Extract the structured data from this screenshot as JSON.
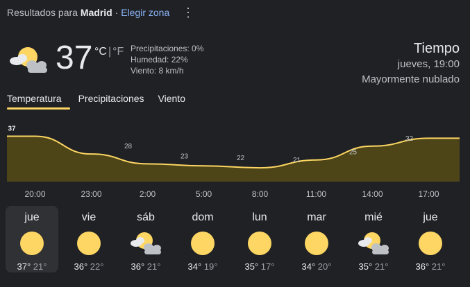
{
  "header": {
    "prefix": "Resultados para",
    "city": "Madrid",
    "separator": "·",
    "change_zone": "Elegir zona",
    "menu_icon": "more-vert-icon"
  },
  "current": {
    "icon": "partly-cloudy-icon",
    "temperature": "37",
    "unit_c": "°C",
    "unit_sep": "|",
    "unit_f": "°F",
    "precipitation": "Precipitaciones: 0%",
    "humidity": "Humedad: 22%",
    "wind": "Viento: 8 km/h"
  },
  "summary": {
    "title": "Tiempo",
    "datetime": "jueves, 19:00",
    "condition": "Mayormente nublado"
  },
  "tabs": [
    {
      "label": "Temperatura",
      "active": true
    },
    {
      "label": "Precipitaciones",
      "active": false
    },
    {
      "label": "Viento",
      "active": false
    }
  ],
  "colors": {
    "accent": "#fdd663",
    "area_fill": "#4d4518",
    "background": "#202124",
    "card": "#303134"
  },
  "chart_data": {
    "type": "area",
    "x": [
      "19:00",
      "20:00",
      "23:00",
      "2:00",
      "5:00",
      "8:00",
      "11:00",
      "14:00",
      "17:00"
    ],
    "values": [
      37,
      37,
      28,
      23,
      22,
      21,
      25,
      32,
      36
    ],
    "labels": [
      "37",
      "",
      "28",
      "23",
      "22",
      "21",
      "25",
      "32",
      "36"
    ],
    "x_tick_labels": [
      "20:00",
      "23:00",
      "2:00",
      "5:00",
      "8:00",
      "11:00",
      "14:00",
      "17:00"
    ]
  },
  "forecast": [
    {
      "day": "jue",
      "icon": "sunny-icon",
      "high": "37°",
      "low": "21°",
      "selected": true
    },
    {
      "day": "vie",
      "icon": "sunny-icon",
      "high": "36°",
      "low": "22°",
      "selected": false
    },
    {
      "day": "sáb",
      "icon": "partly-cloudy-icon",
      "high": "36°",
      "low": "21°",
      "selected": false
    },
    {
      "day": "dom",
      "icon": "sunny-icon",
      "high": "34°",
      "low": "19°",
      "selected": false
    },
    {
      "day": "lun",
      "icon": "sunny-icon",
      "high": "35°",
      "low": "17°",
      "selected": false
    },
    {
      "day": "mar",
      "icon": "sunny-icon",
      "high": "34°",
      "low": "20°",
      "selected": false
    },
    {
      "day": "mié",
      "icon": "partly-cloudy-icon",
      "high": "35°",
      "low": "21°",
      "selected": false
    },
    {
      "day": "jue",
      "icon": "sunny-icon",
      "high": "36°",
      "low": "21°",
      "selected": false
    }
  ]
}
